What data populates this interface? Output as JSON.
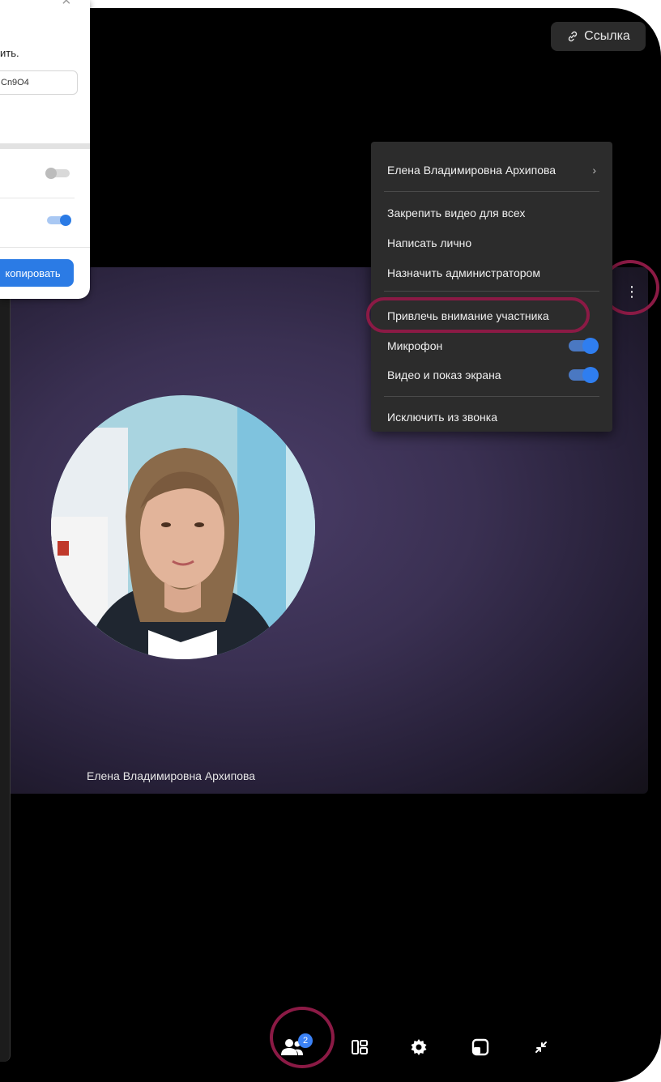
{
  "header": {
    "link_label": "Ссылка"
  },
  "invite_dialog": {
    "text_fragment": "ить.",
    "code_fragment": "Cn9O4",
    "copy_button": "копировать"
  },
  "participant": {
    "name": "Елена Владимировна Архипова"
  },
  "context_menu": {
    "title": "Елена Владимировна Архипова",
    "items": [
      "Закрепить видео для всех",
      "Написать лично",
      "Назначить администратором",
      "Привлечь внимание участника"
    ],
    "toggles": [
      {
        "label": "Микрофон",
        "on": true
      },
      {
        "label": "Видео и показ экрана",
        "on": true
      }
    ],
    "kick": "Исключить из звонка"
  },
  "toolbar": {
    "participants_count": "2"
  },
  "colors": {
    "accent": "#2b7be5",
    "highlight": "#8b1a45",
    "tile_bg": "#3a3052"
  }
}
